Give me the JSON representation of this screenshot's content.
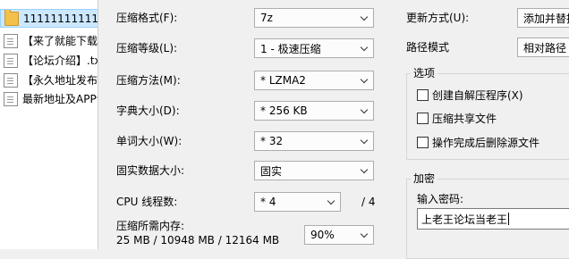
{
  "file_list": [
    {
      "name": "111111111111",
      "icon": "folder-icon",
      "selected": true
    },
    {
      "name": "【来了就能下载",
      "icon": "document-icon"
    },
    {
      "name": "【论坛介绍】.txt",
      "icon": "document-icon"
    },
    {
      "name": "【永久地址发布",
      "icon": "document-icon"
    },
    {
      "name": "最新地址及APP说",
      "icon": "document-icon"
    }
  ],
  "settings": {
    "format": {
      "label": "压缩格式(F):",
      "value": "7z"
    },
    "level": {
      "label": "压缩等级(L):",
      "value": "1 - 极速压缩"
    },
    "method": {
      "label": "压缩方法(M):",
      "value": "* LZMA2"
    },
    "dict": {
      "label": "字典大小(D):",
      "value": "* 256 KB"
    },
    "word": {
      "label": "单词大小(W):",
      "value": "* 32"
    },
    "solid": {
      "label": "固实数据大小:",
      "value": "固实"
    },
    "threads": {
      "label": "CPU 线程数:",
      "value": "* 4",
      "total": "/ 4"
    },
    "memory": {
      "label": "压缩所需内存:",
      "detail": "25 MB / 10948 MB / 12164 MB",
      "percent": "90%"
    }
  },
  "right": {
    "update_mode": {
      "label": "更新方式(U):",
      "value": "添加并替换"
    },
    "path_mode": {
      "label": "路径模式",
      "value": "相对路径"
    },
    "options": {
      "title": "选项",
      "items": [
        "创建自解压程序(X)",
        "压缩共享文件",
        "操作完成后删除源文件"
      ]
    },
    "encryption": {
      "title": "加密",
      "password_label": "输入密码:",
      "password_value": "上老王论坛当老王"
    }
  },
  "colors": {
    "selection": "#cce8ff",
    "window_bg": "#f0f0f0"
  }
}
